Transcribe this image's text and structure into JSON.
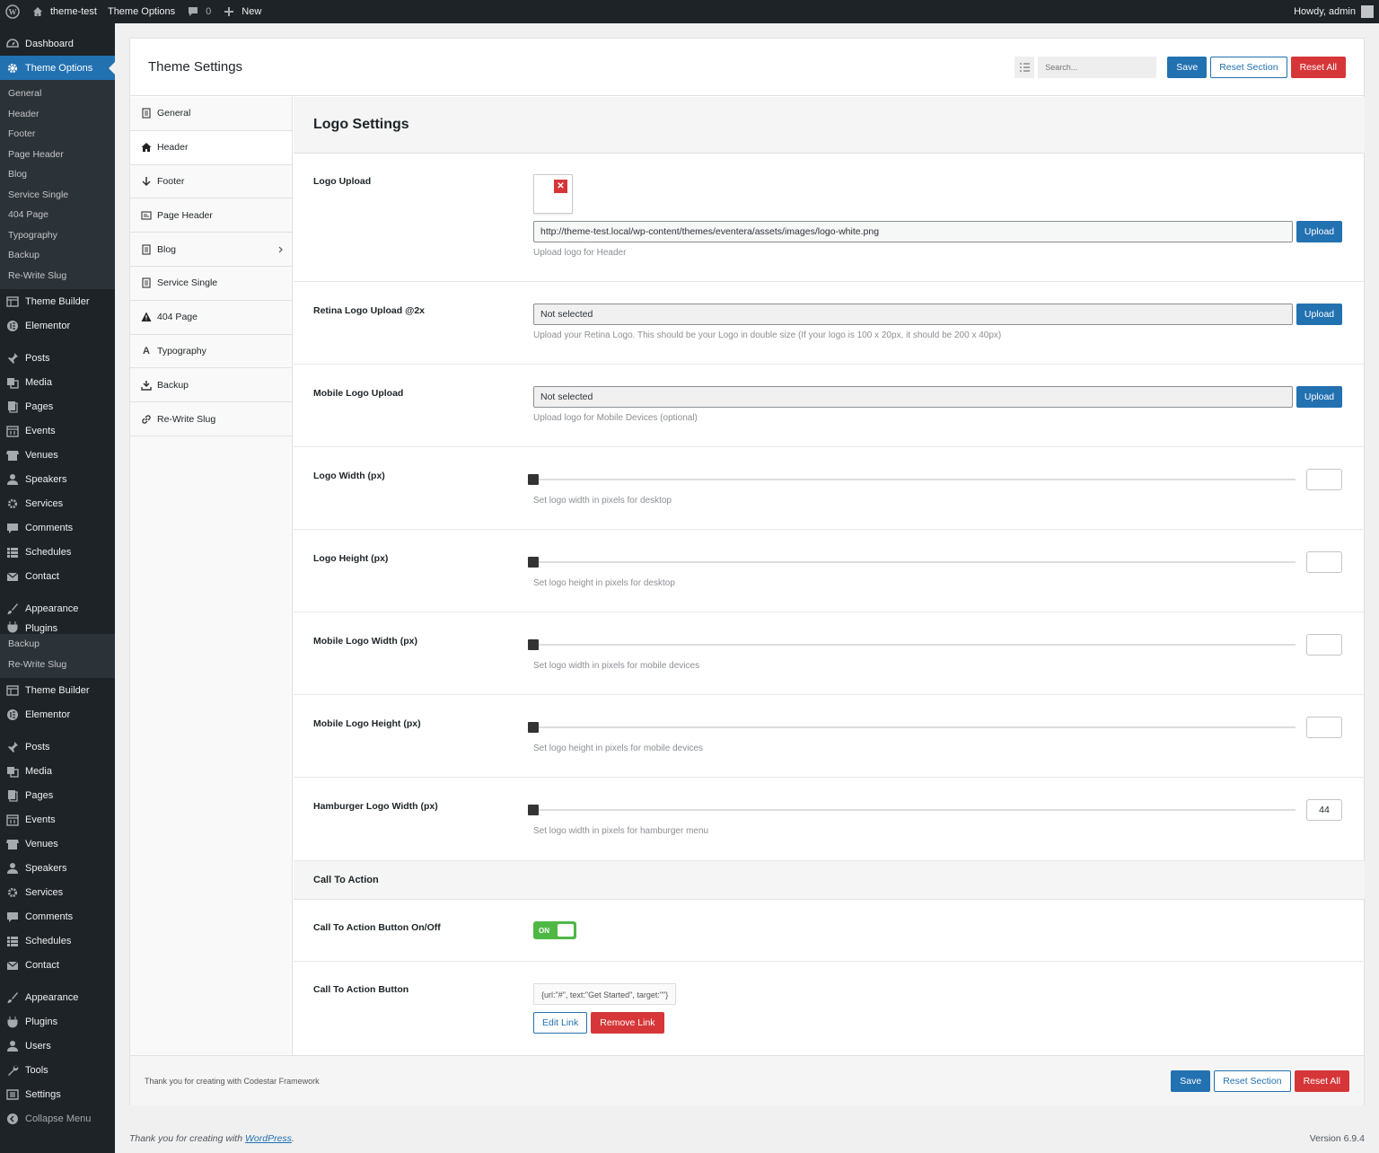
{
  "admin_bar": {
    "site_name": "theme-test",
    "theme_options": "Theme Options",
    "comments_count": "0",
    "new_label": "New",
    "howdy": "Howdy, admin"
  },
  "sidebar": {
    "dashboard": "Dashboard",
    "theme_options": "Theme Options",
    "submenu": [
      "General",
      "Header",
      "Footer",
      "Page Header",
      "Blog",
      "Service Single",
      "404 Page",
      "Typography",
      "Backup",
      "Re-Write Slug"
    ],
    "group1": [
      "Theme Builder",
      "Elementor"
    ],
    "group2": [
      "Posts",
      "Media",
      "Pages",
      "Events",
      "Venues",
      "Speakers",
      "Services",
      "Comments",
      "Schedules",
      "Contact"
    ],
    "appearance": "Appearance",
    "plugins_cut": "Plugins",
    "dup_sub": [
      "Backup",
      "Re-Write Slug"
    ],
    "group1b": [
      "Theme Builder",
      "Elementor"
    ],
    "group2b": [
      "Posts",
      "Media",
      "Pages",
      "Events",
      "Venues",
      "Speakers",
      "Services",
      "Comments",
      "Schedules",
      "Contact"
    ],
    "group3": [
      "Appearance",
      "Plugins",
      "Users",
      "Tools",
      "Settings"
    ],
    "collapse": "Collapse Menu"
  },
  "header": {
    "title": "Theme Settings",
    "search_placeholder": "Search...",
    "save": "Save",
    "reset_section": "Reset Section",
    "reset_all": "Reset All"
  },
  "nav": {
    "items": [
      "General",
      "Header",
      "Footer",
      "Page Header",
      "Blog",
      "Service Single",
      "404 Page",
      "Typography",
      "Backup",
      "Re-Write Slug"
    ],
    "active": "Header"
  },
  "section": {
    "title": "Logo Settings",
    "logo_upload": {
      "label": "Logo Upload",
      "value": "http://theme-test.local/wp-content/themes/eventera/assets/images/logo-white.png",
      "button": "Upload",
      "desc": "Upload logo for Header"
    },
    "retina_upload": {
      "label": "Retina Logo Upload @2x",
      "value": "Not selected",
      "button": "Upload",
      "desc": "Upload your Retina Logo. This should be your Logo in double size (If your logo is 100 x 20px, it should be 200 x 40px)"
    },
    "mobile_upload": {
      "label": "Mobile Logo Upload",
      "value": "Not selected",
      "button": "Upload",
      "desc": "Upload logo for Mobile Devices (optional)"
    },
    "sliders": [
      {
        "label": "Logo Width (px)",
        "desc": "Set logo width in pixels for desktop",
        "value": ""
      },
      {
        "label": "Logo Height (px)",
        "desc": "Set logo height in pixels for desktop",
        "value": ""
      },
      {
        "label": "Mobile Logo Width (px)",
        "desc": "Set logo width in pixels for mobile devices",
        "value": ""
      },
      {
        "label": "Mobile Logo Height (px)",
        "desc": "Set logo height in pixels for mobile devices",
        "value": ""
      },
      {
        "label": "Hamburger Logo Width (px)",
        "desc": "Set logo width in pixels for hamburger menu",
        "value": "44"
      }
    ],
    "cta_heading": "Call To Action",
    "cta_toggle": {
      "label": "Call To Action Button On/Off",
      "state": "ON"
    },
    "cta_button": {
      "label": "Call To Action Button",
      "value": "{url:\"#\", text:\"Get Started\", target:\"\"}",
      "edit": "Edit Link",
      "remove": "Remove Link"
    }
  },
  "footer": {
    "note": "Thank you for creating with Codestar Framework",
    "save": "Save",
    "reset_section": "Reset Section",
    "reset_all": "Reset All"
  },
  "wp_footer": {
    "thanks_prefix": "Thank you for creating with ",
    "wordpress": "WordPress",
    "thanks_suffix": ".",
    "version": "Version 6.9.4"
  },
  "colors": {
    "accent": "#2271b1",
    "danger": "#d63638",
    "toggle_on": "#4fb845",
    "sidebar_bg": "#1d2327"
  }
}
